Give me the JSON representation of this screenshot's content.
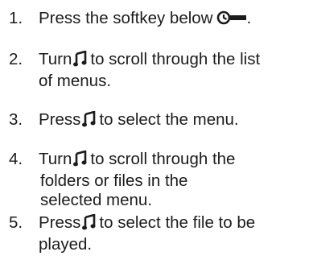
{
  "steps": [
    {
      "number": "1.",
      "before": "Press the softkey below",
      "icon": "softkey-seek-icon",
      "after": "."
    },
    {
      "number": "2.",
      "before": "Turn",
      "icon": "music-note-knob-icon",
      "after_line1": "to scroll through the list",
      "line2": "of menus."
    },
    {
      "number": "3.",
      "before": "Press",
      "icon": "music-note-knob-icon",
      "after": "to select the menu."
    },
    {
      "number": "4.",
      "before": "Turn",
      "icon": "music-note-knob-icon",
      "after_line1": "to scroll through the",
      "line2": "folders or files in the",
      "line3": "selected menu."
    },
    {
      "number": "5.",
      "before": "Press",
      "icon": "music-note-knob-icon",
      "after_line1": "to select the file to be",
      "line2": "played."
    }
  ]
}
